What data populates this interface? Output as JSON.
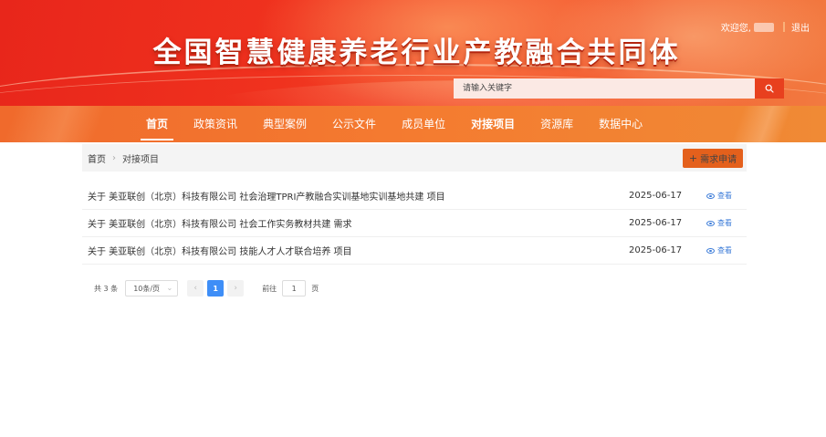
{
  "header": {
    "title": "全国智慧健康养老行业产教融合共同体",
    "welcome": "欢迎您,",
    "logout": "退出",
    "search_placeholder": "请输入关键字"
  },
  "nav": {
    "items": [
      {
        "label": "首页"
      },
      {
        "label": "政策资讯"
      },
      {
        "label": "典型案例"
      },
      {
        "label": "公示文件"
      },
      {
        "label": "成员单位"
      },
      {
        "label": "对接项目"
      },
      {
        "label": "资源库"
      },
      {
        "label": "数据中心"
      }
    ]
  },
  "breadcrumb": {
    "home": "首页",
    "current": "对接项目"
  },
  "apply_button": "需求申请",
  "list": {
    "rows": [
      {
        "title": "关于 美亚联创（北京）科技有限公司 社会治理TPRI产教融合实训基地实训基地共建 项目",
        "date": "2025-06-17",
        "action": "查看"
      },
      {
        "title": "关于 美亚联创（北京）科技有限公司 社会工作实务教材共建 需求",
        "date": "2025-06-17",
        "action": "查看"
      },
      {
        "title": "关于 美亚联创（北京）科技有限公司 技能人才人才联合培养 项目",
        "date": "2025-06-17",
        "action": "查看"
      }
    ]
  },
  "pagination": {
    "total": "共 3 条",
    "page_size": "10条/页",
    "current_page": "1",
    "goto_label": "前往",
    "goto_value": "1",
    "goto_suffix": "页"
  },
  "colors": {
    "brand_red": "#e8261b",
    "nav_orange": "#f47b30",
    "button_orange": "#e4601c",
    "link_blue": "#3b7bd8",
    "page_active": "#3e8ef7"
  }
}
